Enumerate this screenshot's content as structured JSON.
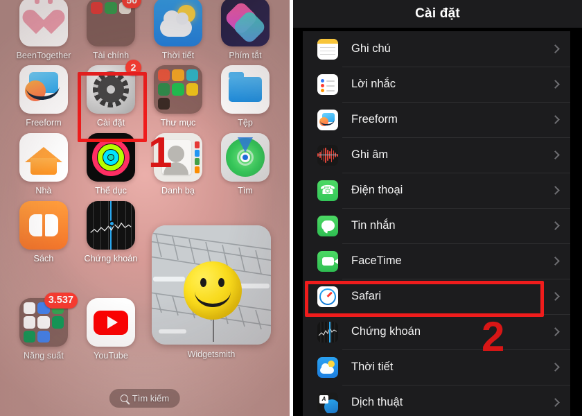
{
  "home": {
    "apps": [
      {
        "name": "BeenTogether",
        "label": "BeenTogether",
        "badge": null
      },
      {
        "name": "Tài chính",
        "label": "Tài chính",
        "badge": "50"
      },
      {
        "name": "Thời tiết",
        "label": "Thời tiết",
        "badge": null
      },
      {
        "name": "Phím tắt",
        "label": "Phím tắt",
        "badge": null
      },
      {
        "name": "Freeform",
        "label": "Freeform",
        "badge": null
      },
      {
        "name": "Cài đặt",
        "label": "Cài đặt",
        "badge": "2"
      },
      {
        "name": "Thư mục",
        "label": "Thư mục",
        "badge": null
      },
      {
        "name": "Tệp",
        "label": "Tệp",
        "badge": null
      },
      {
        "name": "Nhà",
        "label": "Nhà",
        "badge": null
      },
      {
        "name": "Thể dục",
        "label": "Thể dục",
        "badge": null
      },
      {
        "name": "Danh bạ",
        "label": "Danh bạ",
        "badge": null
      },
      {
        "name": "Tìm",
        "label": "Tìm",
        "badge": null
      },
      {
        "name": "Sách",
        "label": "Sách",
        "badge": null
      },
      {
        "name": "Chứng khoán",
        "label": "Chứng khoán",
        "badge": null
      },
      {
        "name": "Năng suất",
        "label": "Năng suất",
        "badge": "3.537"
      },
      {
        "name": "YouTube",
        "label": "YouTube",
        "badge": null
      }
    ],
    "widget": {
      "label": "Widgetsmith"
    },
    "search": {
      "label": "Tìm kiếm",
      "icon": "search-icon"
    }
  },
  "annotations": {
    "step_one": "1",
    "step_two": "2",
    "highlight_color": "#ef1c1c",
    "number_color": "#d81616"
  },
  "settings": {
    "title": "Cài đặt",
    "chevron_icon": "chevron-right-icon",
    "rows": [
      {
        "label": "Ghi chú",
        "icon": "notes-icon"
      },
      {
        "label": "Lời nhắc",
        "icon": "reminders-icon"
      },
      {
        "label": "Freeform",
        "icon": "freeform-icon"
      },
      {
        "label": "Ghi âm",
        "icon": "voice-memos-icon"
      },
      {
        "label": "Điện thoại",
        "icon": "phone-icon"
      },
      {
        "label": "Tin nhắn",
        "icon": "messages-icon"
      },
      {
        "label": "FaceTime",
        "icon": "facetime-icon"
      },
      {
        "label": "Safari",
        "icon": "safari-icon",
        "highlighted": true
      },
      {
        "label": "Chứng khoán",
        "icon": "stocks-icon"
      },
      {
        "label": "Thời tiết",
        "icon": "weather-icon"
      },
      {
        "label": "Dịch thuật",
        "icon": "translate-icon"
      }
    ]
  }
}
